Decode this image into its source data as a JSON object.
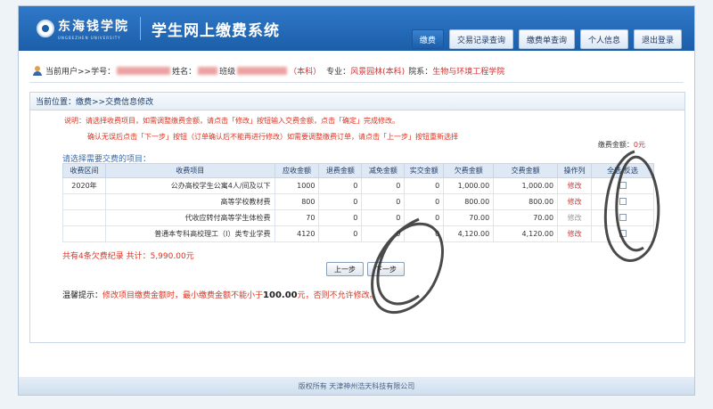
{
  "header": {
    "logo_text": "东海钱学院",
    "logo_en": "UNGBEZHEN UNIVERSITY",
    "system_title": "学生网上缴费系统",
    "nav": [
      "缴费",
      "交易记录查询",
      "缴费单查询",
      "个人信息",
      "退出登录"
    ]
  },
  "userbar": {
    "current_user_label": "当前用户>>",
    "student_no_label": "学号：",
    "name_label": "姓名：",
    "class_label": "班级",
    "degree": "（本科）",
    "major_label": "专业：",
    "major": "风景园林(本科)",
    "dept_label": "院系：",
    "dept": "生物与环境工程学院"
  },
  "location": "当前位置：缴费>>交费信息修改",
  "notes": {
    "line1": "说明：请选择收费项目，如需调整缴费金额，请点击「修改」按钮输入交费金额，点击「确定」完成修改。",
    "line2": "确认无误后点击「下一步」按钮（订单确认后不能再进行修改）如需要调整缴费订单，请点击「上一步」按钮重新选择"
  },
  "pay_amount_label": "缴费金额：",
  "pay_amount_value": "0元",
  "choose_label": "请选择需要交费的项目：",
  "table": {
    "headers": [
      "收费区间",
      "收费项目",
      "应收金额",
      "退费金额",
      "减免金额",
      "实交金额",
      "欠费金额",
      "交费金额",
      "操作列",
      "全选/反选"
    ],
    "rows": [
      {
        "period": "2020年",
        "item": "公办高校学生公寓4人/间及以下",
        "due": "1000",
        "refund": "0",
        "discount": "0",
        "paid": "0",
        "owed": "1,000.00",
        "pay": "1,000.00",
        "op": "修改"
      },
      {
        "period": "",
        "item": "高等学校教材费",
        "due": "800",
        "refund": "0",
        "discount": "0",
        "paid": "0",
        "owed": "800.00",
        "pay": "800.00",
        "op": "修改"
      },
      {
        "period": "",
        "item": "代收应转付高等学生体检费",
        "due": "70",
        "refund": "0",
        "discount": "0",
        "paid": "0",
        "owed": "70.00",
        "pay": "70.00",
        "op": "修改"
      },
      {
        "period": "",
        "item": "普通本专科高校理工（Ⅰ）类专业学费",
        "due": "4120",
        "refund": "0",
        "discount": "0",
        "paid": "0",
        "owed": "4,120.00",
        "pay": "4,120.00",
        "op": "修改"
      }
    ]
  },
  "summary": "共有4条欠费纪录  共计：5,990.00元",
  "buttons": {
    "prev": "上一步",
    "next": "下一步"
  },
  "tip": {
    "label": "温馨提示：",
    "text1": "修改项目缴费金额时，最小缴费金额不能小于",
    "amount": "100.00",
    "text2": "元，否则不允许修改。"
  },
  "footer": "版权所有 天津神州浩天科技有限公司",
  "colors": {
    "header_blue": "#1c5ea8",
    "accent_red": "#d32"
  }
}
